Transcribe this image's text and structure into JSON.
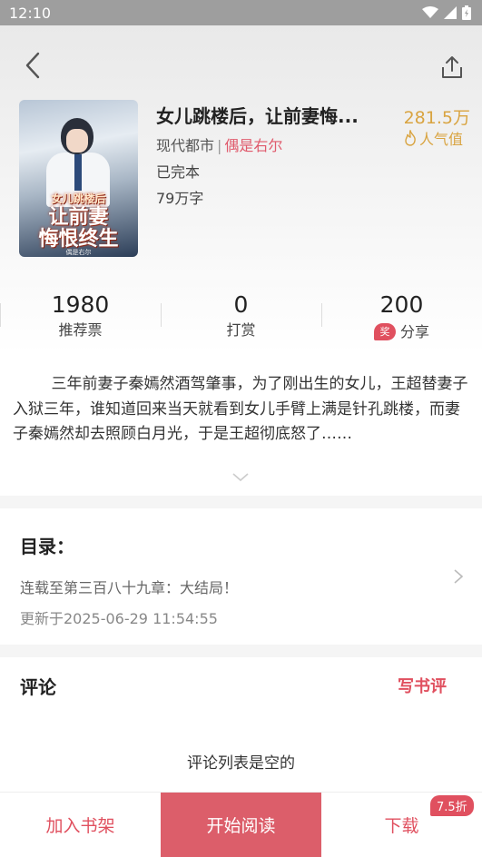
{
  "status_bar": {
    "time": "12:10"
  },
  "book": {
    "title": "女儿跳楼后，让前妻悔...",
    "category": "现代都市",
    "separator": "|",
    "author": "偶是右尔",
    "status": "已完本",
    "word_count": "79万字",
    "popularity_value": "281.5万",
    "popularity_label": "人气值",
    "cover": {
      "line1": "女儿跳楼后",
      "line2": "让前妻",
      "line3": "悔恨终生",
      "author": "偶是右尔"
    }
  },
  "stats": [
    {
      "value": "1980",
      "label": "推荐票"
    },
    {
      "value": "0",
      "label": "打赏"
    },
    {
      "value": "200",
      "label": "分享",
      "badge": "奖"
    }
  ],
  "summary": "三年前妻子秦嫣然酒驾肇事，为了刚出生的女儿，王超替妻子入狱三年，谁知道回来当天就看到女儿手臂上满是针孔跳楼，而妻子秦嫣然却去照顾白月光，于是王超彻底怒了……",
  "toc": {
    "header": "目录：",
    "latest": "连载至第三百八十九章：大结局！",
    "updated": "更新于2025-06-29 11:54:55"
  },
  "comments": {
    "header": "评论",
    "write_label": "写书评",
    "empty_text": "评论列表是空的"
  },
  "bottom_bar": {
    "shelf_label": "加入书架",
    "read_label": "开始阅读",
    "download_label": "下载",
    "discount_label": "7.5折"
  },
  "colors": {
    "accent": "#e0505f",
    "read_button": "#dc5e6a",
    "popularity": "#d9a441"
  },
  "icons": [
    "back-arrow-icon",
    "share-icon",
    "flame-icon",
    "chevron-down-icon",
    "chevron-right-icon",
    "wifi-icon",
    "signal-icon",
    "battery-icon"
  ]
}
